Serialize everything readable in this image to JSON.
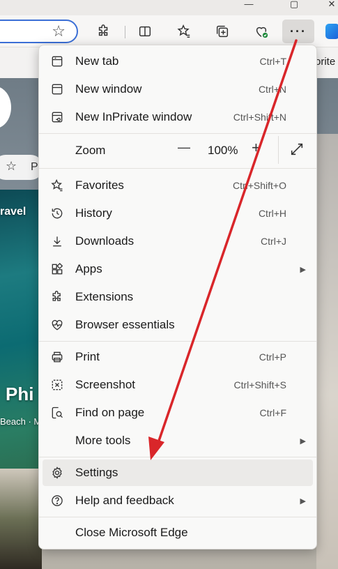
{
  "toolbar": {
    "more_label": "···",
    "fav_fragment": "orite"
  },
  "page": {
    "travel_fragment": "ravel",
    "phi_fragment": "Phi",
    "beach_fragment": "Beach · M",
    "pill_fragment": "P"
  },
  "menu": {
    "items": [
      {
        "label": "New tab",
        "shortcut": "Ctrl+T",
        "icon": "new-tab-icon"
      },
      {
        "label": "New window",
        "shortcut": "Ctrl+N",
        "icon": "new-window-icon"
      },
      {
        "label": "New InPrivate window",
        "shortcut": "Ctrl+Shift+N",
        "icon": "inprivate-icon"
      },
      {
        "label": "Favorites",
        "shortcut": "Ctrl+Shift+O",
        "icon": "favorites-icon"
      },
      {
        "label": "History",
        "shortcut": "Ctrl+H",
        "icon": "history-icon"
      },
      {
        "label": "Downloads",
        "shortcut": "Ctrl+J",
        "icon": "downloads-icon"
      },
      {
        "label": "Apps",
        "shortcut": "",
        "icon": "apps-icon"
      },
      {
        "label": "Extensions",
        "shortcut": "",
        "icon": "extensions-icon"
      },
      {
        "label": "Browser essentials",
        "shortcut": "",
        "icon": "browser-essentials-icon"
      },
      {
        "label": "Print",
        "shortcut": "Ctrl+P",
        "icon": "print-icon"
      },
      {
        "label": "Screenshot",
        "shortcut": "Ctrl+Shift+S",
        "icon": "screenshot-icon"
      },
      {
        "label": "Find on page",
        "shortcut": "Ctrl+F",
        "icon": "find-icon"
      },
      {
        "label": "More tools",
        "shortcut": "",
        "icon": ""
      },
      {
        "label": "Settings",
        "shortcut": "",
        "icon": "settings-icon"
      },
      {
        "label": "Help and feedback",
        "shortcut": "",
        "icon": "help-icon"
      },
      {
        "label": "Close Microsoft Edge",
        "shortcut": "",
        "icon": ""
      }
    ],
    "zoom": {
      "label": "Zoom",
      "value": "100%",
      "minus": "—",
      "plus": "+"
    },
    "submenu_arrow": "▶"
  },
  "colors": {
    "accent": "#3b6fd6",
    "arrow": "#d9262a",
    "menu_bg": "#f9f9f8",
    "selected_bg": "#ebeae8"
  }
}
